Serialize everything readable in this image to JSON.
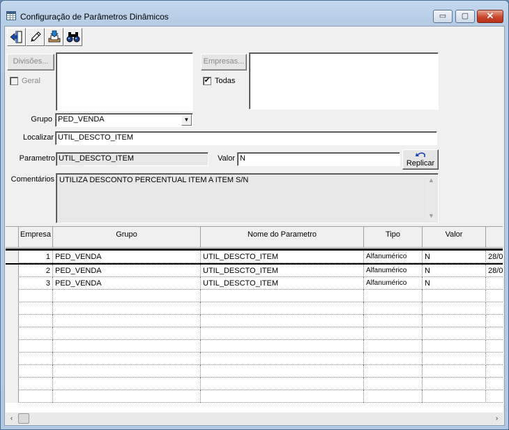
{
  "window": {
    "title": "Configuração de Parâmetros Dinâmicos",
    "min_glyph": "▭",
    "max_glyph": "▢",
    "close_glyph": "✕"
  },
  "toolbar": [
    {
      "name": "exit-button",
      "icon": "door-exit-icon"
    },
    {
      "name": "edit-button",
      "icon": "pencil-icon"
    },
    {
      "name": "save-button",
      "icon": "tray-down-arrow-icon"
    },
    {
      "name": "find-button",
      "icon": "binoculars-icon"
    }
  ],
  "form": {
    "divisoes_button": "Divisões...",
    "empresas_button": "Empresas...",
    "geral_label": "Geral",
    "todas_label": "Todas",
    "todas_checked": true,
    "grupo_label": "Grupo",
    "grupo_value": "PED_VENDA",
    "localizar_label": "Localizar",
    "localizar_value": "UTIL_DESCTO_ITEM",
    "parametro_label": "Parametro",
    "parametro_value": "UTIL_DESCTO_ITEM",
    "valor_label": "Valor",
    "valor_value": "N",
    "replicar_label": "Replicar",
    "comentarios_label": "Comentários",
    "comentarios_value": "UTILIZA DESCONTO PERCENTUAL ITEM A ITEM S/N"
  },
  "grid": {
    "headers": [
      "Empresa",
      "Grupo",
      "Nome do Parametro",
      "Tipo",
      "Valor"
    ],
    "rows": [
      {
        "empresa": "1",
        "grupo": "PED_VENDA",
        "nome": "UTIL_DESCTO_ITEM",
        "tipo": "Alfanumérico",
        "valor": "N",
        "extra": "28/0"
      },
      {
        "empresa": "2",
        "grupo": "PED_VENDA",
        "nome": "UTIL_DESCTO_ITEM",
        "tipo": "Alfanumérico",
        "valor": "N",
        "extra": "28/0"
      },
      {
        "empresa": "3",
        "grupo": "PED_VENDA",
        "nome": "UTIL_DESCTO_ITEM",
        "tipo": "Alfanumérico",
        "valor": "N",
        "extra": ""
      }
    ]
  }
}
